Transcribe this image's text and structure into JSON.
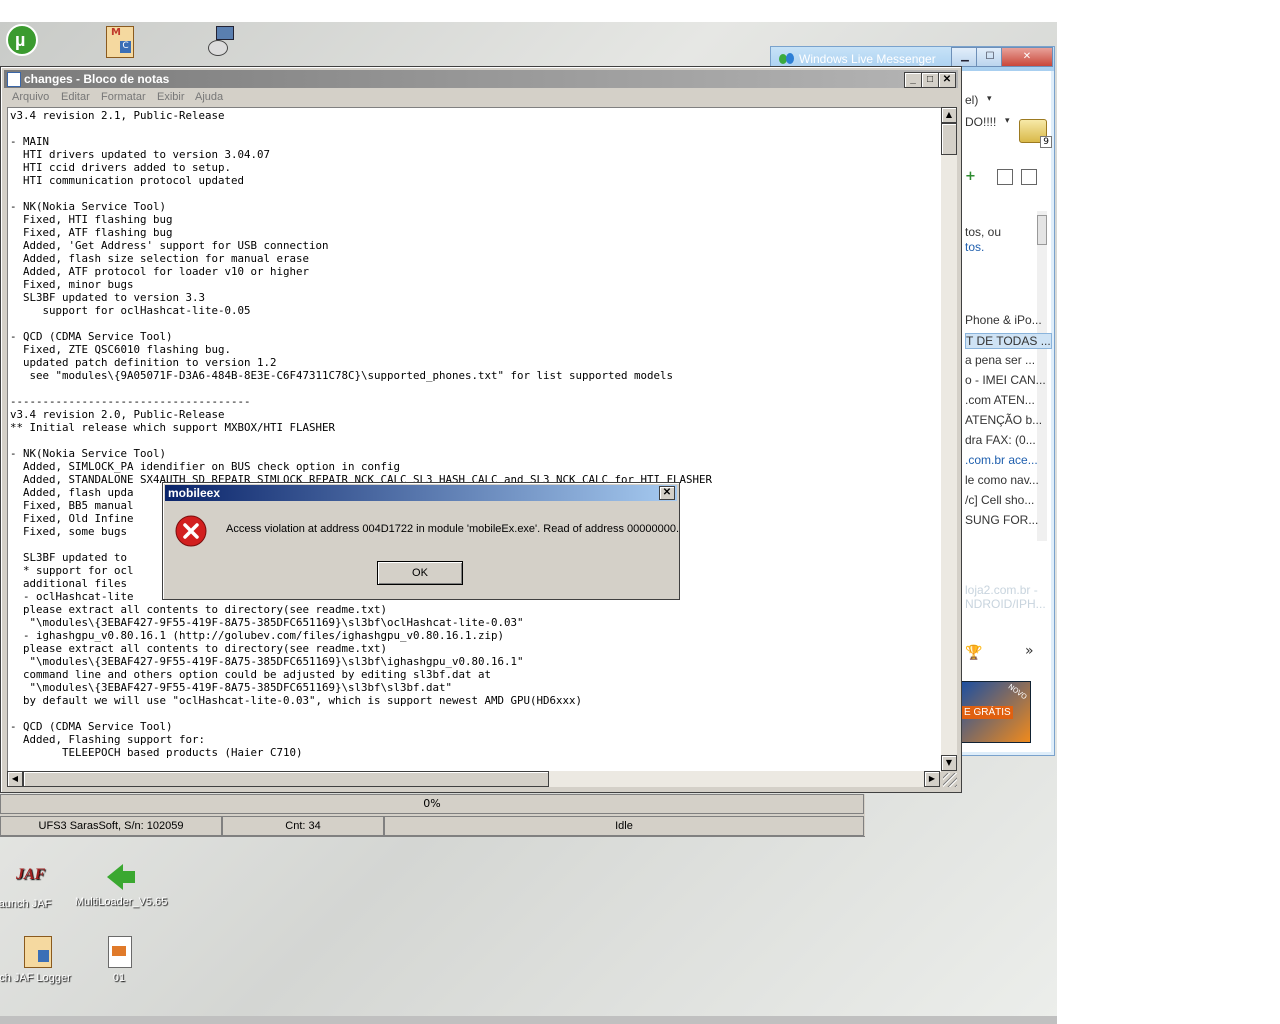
{
  "desktop": {
    "icons": [
      {
        "label": "aunch JAF"
      },
      {
        "label": "MultiLoader_V5.65"
      },
      {
        "label": "ch JAF Logger"
      },
      {
        "label": "01"
      }
    ]
  },
  "messenger": {
    "title": "Windows Live Messenger",
    "status_fragment": "el)",
    "message_fragment": "DO!!!!",
    "notification_count": "9",
    "info_text_1": "tos, ou",
    "info_text_2": "tos.",
    "list_items": [
      "Phone & iPo...",
      "T DE TODAS ...",
      "a pena ser ...",
      "o - IMEI CAN...",
      ".com ATEN...",
      "ATENÇÃO b...",
      "dra FAX: (0...",
      ".com.br ace...",
      "le como nav...",
      "/c] Cell sho...",
      "SUNG FOR..."
    ],
    "faded_1": "loja2.com.br -",
    "faded_2": "NDROID/IPH...",
    "ad_text": "E GRÁTIS",
    "ad_badge": "NOVO",
    "more_chevron": "»"
  },
  "ufs": {
    "progress": "0%",
    "status_device": "UFS3 SarasSoft, S/n: 102059",
    "status_cnt": "Cnt: 34",
    "status_state": "Idle"
  },
  "notepad": {
    "title": "changes - Bloco de notas",
    "menu": [
      "Arquivo",
      "Editar",
      "Formatar",
      "Exibir",
      "Ajuda"
    ],
    "content": "v3.4 revision 2.1, Public-Release\n\n- MAIN\n  HTI drivers updated to version 3.04.07\n  HTI ccid drivers added to setup.\n  HTI communication protocol updated\n\n- NK(Nokia Service Tool)\n  Fixed, HTI flashing bug\n  Fixed, ATF flashing bug\n  Added, 'Get Address' support for USB connection\n  Added, flash size selection for manual erase\n  Added, ATF protocol for loader v10 or higher\n  Fixed, minor bugs\n  SL3BF updated to version 3.3\n     support for oclHashcat-lite-0.05\n\n- QCD (CDMA Service Tool)\n  Fixed, ZTE QSC6010 flashing bug.\n  updated patch definition to version 1.2\n   see \"modules\\{9A05071F-D3A6-484B-8E3E-C6F47311C78C}\\supported_phones.txt\" for list supported models\n\n-------------------------------------\nv3.4 revision 2.0, Public-Release\n** Initial release which support MXBOX/HTI FLASHER\n\n- NK(Nokia Service Tool)\n  Added, SIMLOCK_PA idendifier on BUS check option in config\n  Added, STANDALONE SX4AUTH SD REPAIR SIMLOCK REPAIR NCK CALC SL3 HASH CALC and SL3 NCK CALC for HTI FLASHER\n  Added, flash upda\n  Fixed, BB5 manual\n  Fixed, Old Infine\n  Fixed, some bugs\n\n  SL3BF updated to\n  * support for ocl\n  additional files\n  - oclHashcat-lite\n  please extract all contents to directory(see readme.txt)\n   \"\\modules\\{3EBAF427-9F55-419F-8A75-385DFC651169}\\sl3bf\\oclHashcat-lite-0.03\"\n  - ighashgpu_v0.80.16.1 (http://golubev.com/files/ighashgpu_v0.80.16.1.zip)\n  please extract all contents to directory(see readme.txt)\n   \"\\modules\\{3EBAF427-9F55-419F-8A75-385DFC651169}\\sl3bf\\ighashgpu_v0.80.16.1\"\n  command line and others option could be adjusted by editing sl3bf.dat at\n   \"\\modules\\{3EBAF427-9F55-419F-8A75-385DFC651169}\\sl3bf\\sl3bf.dat\"\n  by default we will use \"oclHashcat-lite-0.03\", which is support newest AMD GPU(HD6xxx)\n\n- QCD (CDMA Service Tool)\n  Added, Flashing support for:\n        TELEEPOCH based products (Haier C710)"
  },
  "dialog": {
    "title": "mobileex",
    "message": "Access violation at address 004D1722 in module 'mobileEx.exe'. Read of address 00000000.",
    "ok_label": "OK",
    "close_glyph": "✕"
  },
  "colors": {
    "dialog_title": "#0a246a",
    "error_red": "#d21f1f",
    "msn_blue": "#a8cff0"
  }
}
